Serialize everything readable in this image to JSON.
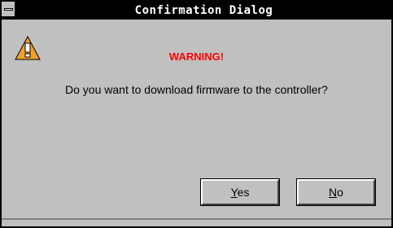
{
  "window": {
    "title": "Confirmation Dialog"
  },
  "dialog": {
    "icon": "warning-triangle-icon",
    "warning_label": "WARNING!",
    "message": "Do you want to download firmware to the controller?"
  },
  "buttons": {
    "yes": {
      "mnemonic": "Y",
      "rest": "es"
    },
    "no": {
      "mnemonic": "N",
      "rest": "o"
    }
  },
  "colors": {
    "titlebar": "#000000",
    "warning_text": "#ff0000",
    "dialog_bg": "#c0c0c0",
    "icon_fill": "#f0a030"
  }
}
